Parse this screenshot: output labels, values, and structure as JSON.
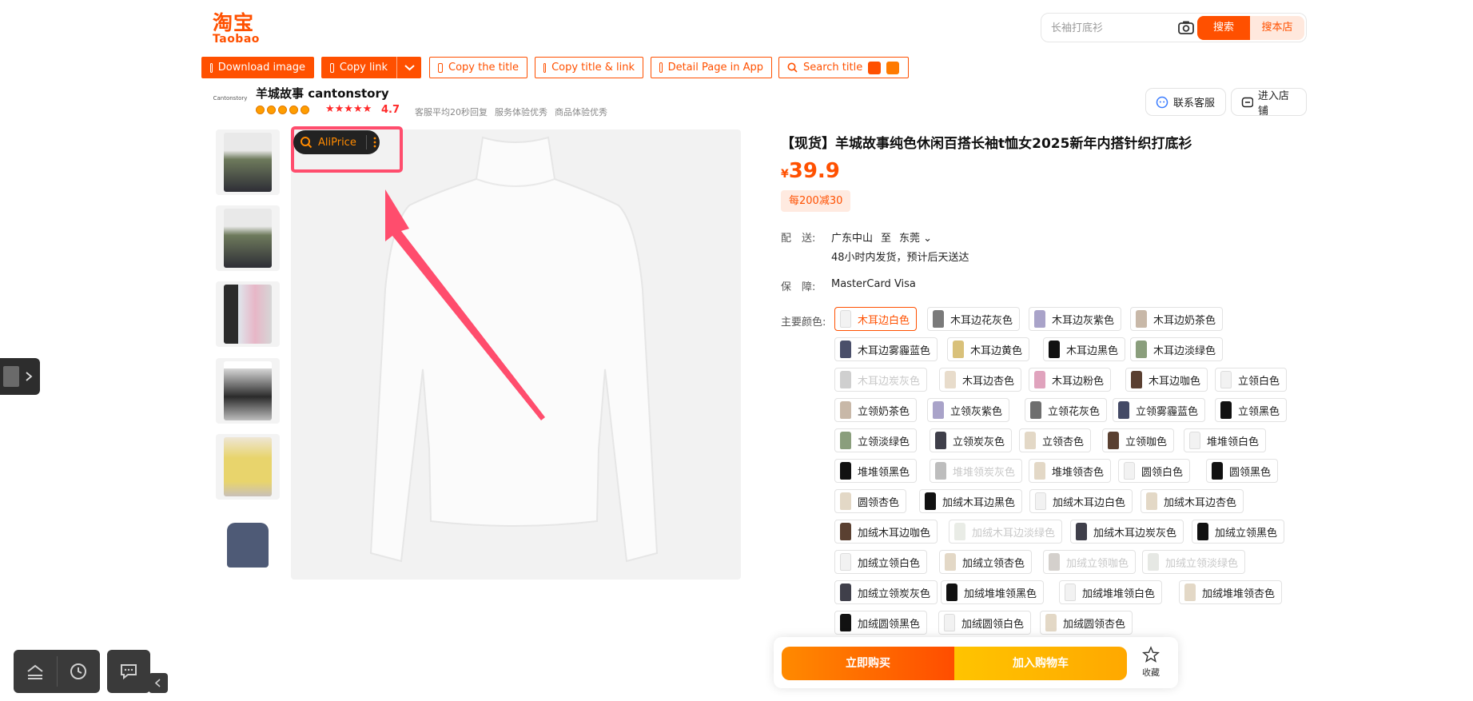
{
  "logo": {
    "cn": "淘宝",
    "en": "Taobao"
  },
  "search": {
    "placeholder": "长袖打底衫",
    "search_label": "搜索",
    "store_label": "搜本店",
    "icon": "camera-icon"
  },
  "toolbar": {
    "download_image": "Download image",
    "copy_link": "Copy link",
    "copy_title": "Copy the title",
    "copy_title_link": "Copy title & link",
    "detail_in_app": "Detail Page in App",
    "search_title": "Search title"
  },
  "shop": {
    "logo_text": "Cantonstory",
    "name": "羊城故事 cantonstory",
    "stars": "★★★★★",
    "rating": "4.7",
    "meta": [
      "客服平均20秒回复",
      "服务体验优秀",
      "商品体验优秀"
    ],
    "contact_label": "联系客服",
    "enter_store_label": "进入店铺"
  },
  "aliprice": {
    "label": "AliPrice"
  },
  "product": {
    "title": "【现货】羊城故事纯色休闲百搭长袖t恤女2025新年内搭针织打底衫",
    "currency": "¥",
    "price": "39.9",
    "promo": "每200减30",
    "shipping_label": "配　送:",
    "ship_from": "广东中山",
    "ship_to_word": "至",
    "ship_to": "东莞",
    "ship_note": "48小时内发货，预计后天送达",
    "guarantee_label": "保　障:",
    "guarantee_value": "MasterCard Visa",
    "color_label": "主要颜色:"
  },
  "colors": [
    {
      "name": "木耳边白色",
      "chip": "#f2f2f2",
      "state": "selected"
    },
    {
      "name": "木耳边花灰色",
      "chip": "#7a7a7a",
      "state": "normal"
    },
    {
      "name": "木耳边灰紫色",
      "chip": "#a9a3c9",
      "state": "normal"
    },
    {
      "name": "木耳边奶茶色",
      "chip": "#c8b8a8",
      "state": "normal"
    },
    {
      "name": "木耳边雾霾蓝色",
      "chip": "#4a4f6a",
      "state": "normal"
    },
    {
      "name": "木耳边黄色",
      "chip": "#d9c17a",
      "state": "normal"
    },
    {
      "name": "木耳边黑色",
      "chip": "#111111",
      "state": "normal"
    },
    {
      "name": "木耳边淡绿色",
      "chip": "#8a9e7c",
      "state": "normal"
    },
    {
      "name": "木耳边炭灰色",
      "chip": "#cfcfcf",
      "state": "disabled"
    },
    {
      "name": "木耳边杏色",
      "chip": "#e8dccb",
      "state": "normal"
    },
    {
      "name": "木耳边粉色",
      "chip": "#e0a3bd",
      "state": "normal"
    },
    {
      "name": "木耳边咖色",
      "chip": "#5a4031",
      "state": "normal"
    },
    {
      "name": "立领白色",
      "chip": "#f2f2f2",
      "state": "normal"
    },
    {
      "name": "立领奶茶色",
      "chip": "#c8b8a8",
      "state": "normal"
    },
    {
      "name": "立领灰紫色",
      "chip": "#a9a3c9",
      "state": "normal"
    },
    {
      "name": "立领花灰色",
      "chip": "#6e6e6e",
      "state": "normal"
    },
    {
      "name": "立领雾霾蓝色",
      "chip": "#444a66",
      "state": "normal"
    },
    {
      "name": "立领黑色",
      "chip": "#111111",
      "state": "normal"
    },
    {
      "name": "立领淡绿色",
      "chip": "#8a9e7c",
      "state": "normal"
    },
    {
      "name": "立领炭灰色",
      "chip": "#3f3f4a",
      "state": "normal"
    },
    {
      "name": "立领杏色",
      "chip": "#e3d8c6",
      "state": "normal"
    },
    {
      "name": "立领咖色",
      "chip": "#5a4031",
      "state": "normal"
    },
    {
      "name": "堆堆领白色",
      "chip": "#f2f2f2",
      "state": "normal"
    },
    {
      "name": "堆堆领黑色",
      "chip": "#111111",
      "state": "normal"
    },
    {
      "name": "堆堆领炭灰色",
      "chip": "#bdbdbd",
      "state": "disabled"
    },
    {
      "name": "堆堆领杏色",
      "chip": "#e3d8c6",
      "state": "normal"
    },
    {
      "name": "圆领白色",
      "chip": "#f2f2f2",
      "state": "normal"
    },
    {
      "name": "圆领黑色",
      "chip": "#111111",
      "state": "normal"
    },
    {
      "name": "圆领杏色",
      "chip": "#e3d8c6",
      "state": "normal"
    },
    {
      "name": "加绒木耳边黑色",
      "chip": "#111111",
      "state": "normal"
    },
    {
      "name": "加绒木耳边白色",
      "chip": "#f2f2f2",
      "state": "normal"
    },
    {
      "name": "加绒木耳边杏色",
      "chip": "#e3d8c6",
      "state": "normal"
    },
    {
      "name": "加绒木耳边咖色",
      "chip": "#5a4031",
      "state": "normal"
    },
    {
      "name": "加绒木耳边淡绿色",
      "chip": "#e9ece6",
      "state": "disabled"
    },
    {
      "name": "加绒木耳边炭灰色",
      "chip": "#3f3f4a",
      "state": "normal"
    },
    {
      "name": "加绒立领黑色",
      "chip": "#111111",
      "state": "normal"
    },
    {
      "name": "加绒立领白色",
      "chip": "#f2f2f2",
      "state": "normal"
    },
    {
      "name": "加绒立领杏色",
      "chip": "#e3d8c6",
      "state": "normal"
    },
    {
      "name": "加绒立领咖色",
      "chip": "#d4d0cc",
      "state": "disabled"
    },
    {
      "name": "加绒立领淡绿色",
      "chip": "#e6e8e4",
      "state": "disabled"
    },
    {
      "name": "加绒立领炭灰色",
      "chip": "#3f3f4a",
      "state": "normal"
    },
    {
      "name": "加绒堆堆领黑色",
      "chip": "#111111",
      "state": "normal"
    },
    {
      "name": "加绒堆堆领白色",
      "chip": "#f2f2f2",
      "state": "normal"
    },
    {
      "name": "加绒堆堆领杏色",
      "chip": "#e3d8c6",
      "state": "normal"
    },
    {
      "name": "加绒圆领黑色",
      "chip": "#111111",
      "state": "normal"
    },
    {
      "name": "加绒圆领白色",
      "chip": "#f2f2f2",
      "state": "normal"
    },
    {
      "name": "加绒圆领杏色",
      "chip": "#e3d8c6",
      "state": "normal"
    }
  ],
  "actions": {
    "buy_now": "立即购买",
    "add_to_cart": "加入购物车",
    "favorite": "收藏"
  },
  "theme": {
    "brand": "#ff5000",
    "highlight": "#ff4d6d"
  }
}
